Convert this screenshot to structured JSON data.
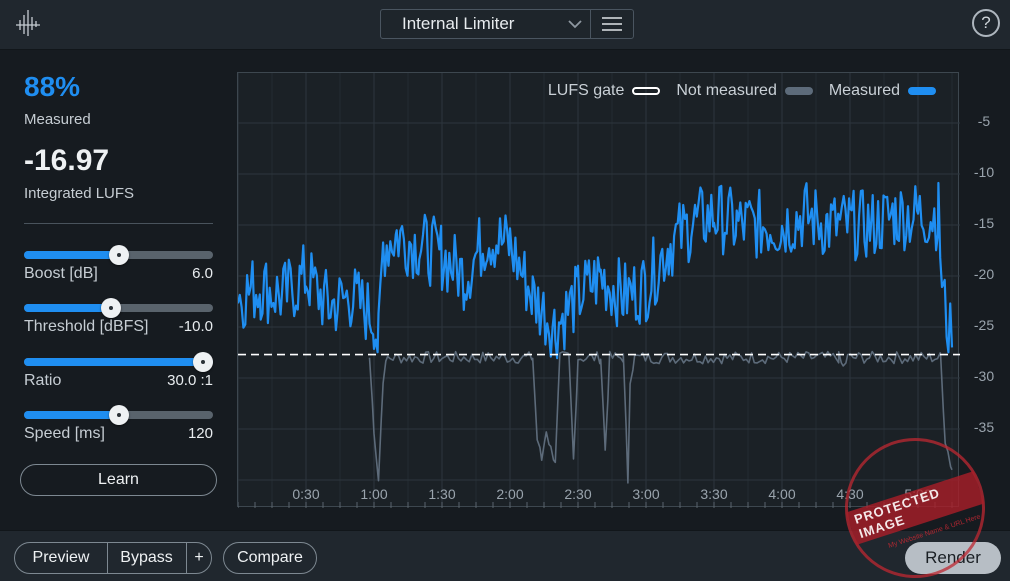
{
  "header": {
    "preset_name": "Internal Limiter",
    "logo_icon": "waveform-logo-icon",
    "menu_icon": "hamburger-menu-icon",
    "help_label": "?"
  },
  "stats": {
    "measured_percent": "88%",
    "measured_label": "Measured",
    "integrated_value": "-16.97",
    "integrated_label": "Integrated LUFS"
  },
  "sliders": [
    {
      "label": "Boost [dB]",
      "value": "6.0",
      "fraction": 0.5
    },
    {
      "label": "Threshold [dBFS]",
      "value": "-10.0",
      "fraction": 0.46
    },
    {
      "label": "Ratio",
      "value": "30.0 :1",
      "fraction": 1.0
    },
    {
      "label": "Speed [ms]",
      "value": "120",
      "fraction": 0.5
    }
  ],
  "learn_label": "Learn",
  "legend": {
    "gate": "LUFS gate",
    "not_measured": "Not measured",
    "measured": "Measured"
  },
  "colors": {
    "accent": "#1f8ef1",
    "not_measured": "#5d6b7a",
    "gate": "#ffffff",
    "background": "#161b20"
  },
  "chart_data": {
    "type": "line",
    "x_ticks": [
      "0:30",
      "1:00",
      "1:30",
      "2:00",
      "2:30",
      "3:00",
      "3:30",
      "4:00",
      "4:30",
      "5:00"
    ],
    "y_ticks": [
      "-5",
      "-10",
      "-15",
      "-20",
      "-25",
      "-30",
      "-35"
    ],
    "ylim": [
      -40,
      0
    ],
    "xlim_seconds": [
      0,
      315
    ],
    "gate_lufs": -27.7,
    "series": [
      {
        "name": "Measured",
        "x": [
          0,
          10,
          20,
          30,
          40,
          50,
          60,
          62,
          64,
          70,
          80,
          90,
          100,
          110,
          120,
          130,
          140,
          150,
          160,
          170,
          180,
          190,
          200,
          210,
          220,
          230,
          240,
          250,
          260,
          270,
          280,
          290,
          300,
          309,
          311,
          315
        ],
        "y": [
          -22,
          -21,
          -22,
          -20,
          -23,
          -22,
          -24,
          -27,
          -17,
          -16,
          -17,
          -18,
          -20,
          -16,
          -17,
          -22,
          -25,
          -22,
          -20,
          -22,
          -21,
          -17,
          -15,
          -14,
          -15,
          -15,
          -15,
          -14,
          -15,
          -15,
          -15,
          -14,
          -14,
          -14,
          -22,
          -27
        ]
      },
      {
        "name": "Not measured",
        "x": [
          58,
          60,
          62,
          64,
          66,
          130,
          132,
          134,
          136,
          138,
          140,
          142,
          146,
          148,
          150,
          160,
          162,
          164,
          170,
          172,
          173,
          175,
          265,
          267,
          269,
          310,
          312,
          315
        ],
        "y": [
          -28,
          -35,
          -40,
          -30,
          -28,
          -28,
          -36,
          -38,
          -35,
          -37,
          -38,
          -28,
          -28,
          -38,
          -28,
          -28,
          -37,
          -28,
          -28,
          -40,
          -30,
          -28,
          -28,
          -29,
          -28,
          -28,
          -36,
          -39
        ]
      }
    ]
  },
  "bottom": {
    "preview": "Preview",
    "bypass": "Bypass",
    "plus": "+",
    "compare": "Compare",
    "render": "Render"
  },
  "watermark": {
    "text": "PROTECTED IMAGE",
    "sub": "My Website Name & URL Here"
  }
}
